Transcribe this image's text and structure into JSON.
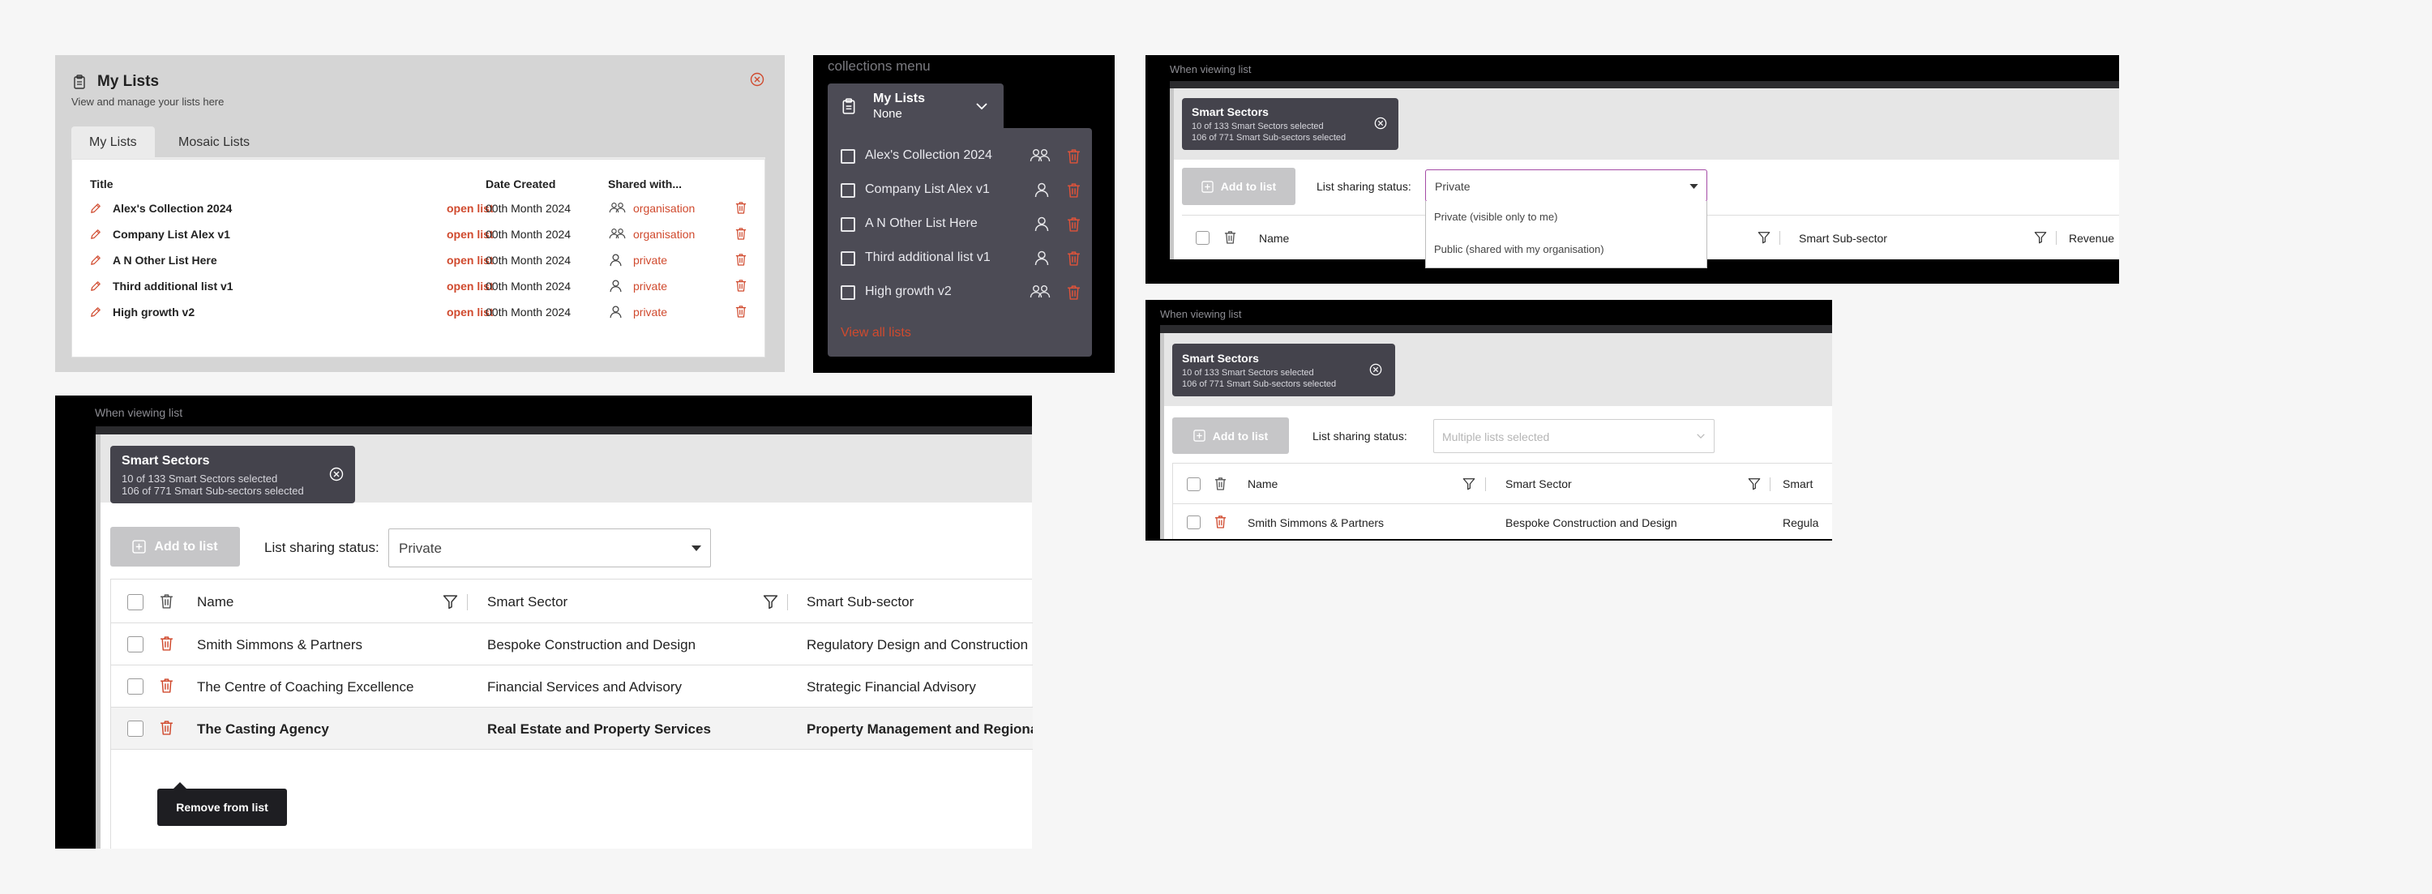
{
  "colors": {
    "accent": "#d04a2e",
    "dark_panel": "#4c4b55",
    "chip": "#44434c"
  },
  "my_lists": {
    "title": "My Lists",
    "subtitle": "View and manage your lists here",
    "tabs": [
      "My Lists",
      "Mosaic Lists"
    ],
    "columns": {
      "title": "Title",
      "date": "Date Created",
      "shared": "Shared with..."
    },
    "open_label": "open list",
    "rows": [
      {
        "title": "Alex's Collection 2024",
        "date": "00th Month 2024",
        "shared": "organisation",
        "icon": "group-icon"
      },
      {
        "title": "Company List Alex v1",
        "date": "00th Month 2024",
        "shared": "organisation",
        "icon": "group-icon"
      },
      {
        "title": "A N Other List Here",
        "date": "00th Month 2024",
        "shared": "private",
        "icon": "person-icon"
      },
      {
        "title": "Third additional list v1",
        "date": "00th Month 2024",
        "shared": "private",
        "icon": "person-icon"
      },
      {
        "title": "High growth v2",
        "date": "00th Month 2024",
        "shared": "private",
        "icon": "person-icon"
      }
    ]
  },
  "collections": {
    "caption": "collections menu",
    "header_title": "My Lists",
    "header_value": "None",
    "items": [
      {
        "label": "Alex's Collection 2024",
        "icon": "group-icon"
      },
      {
        "label": "Company List Alex v1",
        "icon": "person-icon"
      },
      {
        "label": "A N Other List Here",
        "icon": "person-icon"
      },
      {
        "label": "Third additional list v1",
        "icon": "person-icon"
      },
      {
        "label": "High growth v2",
        "icon": "group-icon"
      }
    ],
    "view_all": "View all lists"
  },
  "viewing_large": {
    "caption": "When viewing list",
    "chip_title": "Smart Sectors",
    "chip_line1": "10 of 133 Smart Sectors selected",
    "chip_line2": "106 of 771 Smart Sub-sectors selected",
    "add_label": "Add to list",
    "sharing_label": "List sharing status:",
    "sharing_value": "Private",
    "columns": [
      "Name",
      "Smart Sector",
      "Smart Sub-sector"
    ],
    "rows": [
      [
        "Smith Simmons & Partners",
        "Bespoke Construction and Design",
        "Regulatory Design and Construction"
      ],
      [
        "The Centre of Coaching Excellence",
        "Financial Services and Advisory",
        "Strategic Financial Advisory"
      ],
      [
        "The Casting Agency",
        "Real Estate and Property Services",
        "Property Management and Regional S"
      ]
    ],
    "tooltip": "Remove from list"
  },
  "viewing_dropdown": {
    "caption": "When viewing list",
    "chip_title": "Smart Sectors",
    "chip_line1": "10 of 133 Smart Sectors selected",
    "chip_line2": "106 of 771 Smart Sub-sectors selected",
    "add_label": "Add to list",
    "sharing_label": "List sharing status:",
    "sharing_value": "Private",
    "options": [
      "Private (visible only to me)",
      "Public (shared with my organisation)"
    ],
    "columns": [
      "Name",
      "Smart Sub-sector",
      "Revenue"
    ]
  },
  "viewing_multi": {
    "caption": "When viewing list",
    "chip_title": "Smart Sectors",
    "chip_line1": "10 of 133 Smart Sectors selected",
    "chip_line2": "106 of 771 Smart Sub-sectors selected",
    "add_label": "Add to list",
    "sharing_label": "List sharing status:",
    "sharing_placeholder": "Multiple lists selected",
    "columns": [
      "Name",
      "Smart Sector",
      "Smart"
    ],
    "row": [
      "Smith Simmons & Partners",
      "Bespoke Construction and Design",
      "Regula"
    ]
  }
}
